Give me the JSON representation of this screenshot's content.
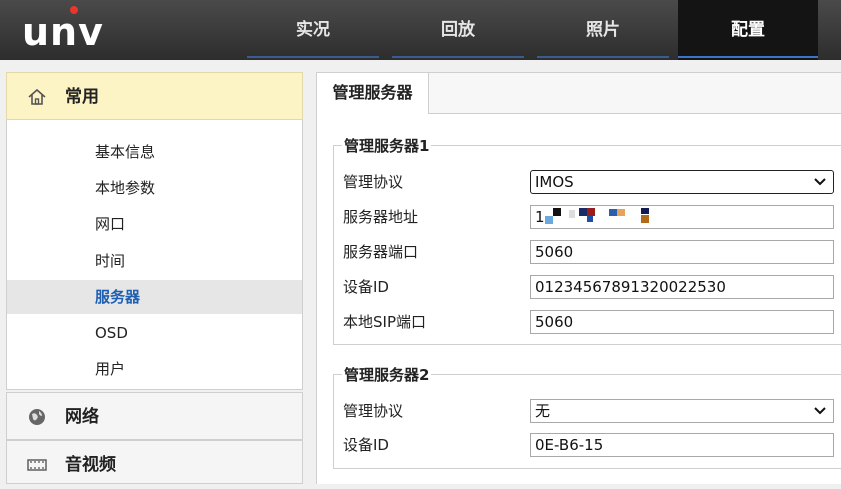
{
  "header": {
    "logo_text": "UNV",
    "tabs": [
      "实况",
      "回放",
      "照片",
      "配置"
    ],
    "active_tab": 3
  },
  "sidebar": {
    "section_common": "常用",
    "items": [
      "基本信息",
      "本地参数",
      "网口",
      "时间",
      "服务器",
      "OSD",
      "用户"
    ],
    "active_item": 4,
    "section_network": "网络",
    "section_av": "音视频"
  },
  "main": {
    "tab_label": "管理服务器",
    "server1": {
      "title": "管理服务器1",
      "protocol_label": "管理协议",
      "protocol_value": "IMOS",
      "address_label": "服务器地址",
      "address_value": "1",
      "port_label": "服务器端口",
      "port_value": "5060",
      "device_id_label": "设备ID",
      "device_id_value": "01234567891320022530",
      "local_sip_label": "本地SIP端口",
      "local_sip_value": "5060"
    },
    "server2": {
      "title": "管理服务器2",
      "protocol_label": "管理协议",
      "protocol_value": "无",
      "device_id_label": "设备ID",
      "device_id_value": "0E-B6-15"
    }
  },
  "colors": {
    "accent": "#1e5fb3",
    "active_section_bg": "#fdf4c6",
    "topbar": "#2d2d2d"
  }
}
